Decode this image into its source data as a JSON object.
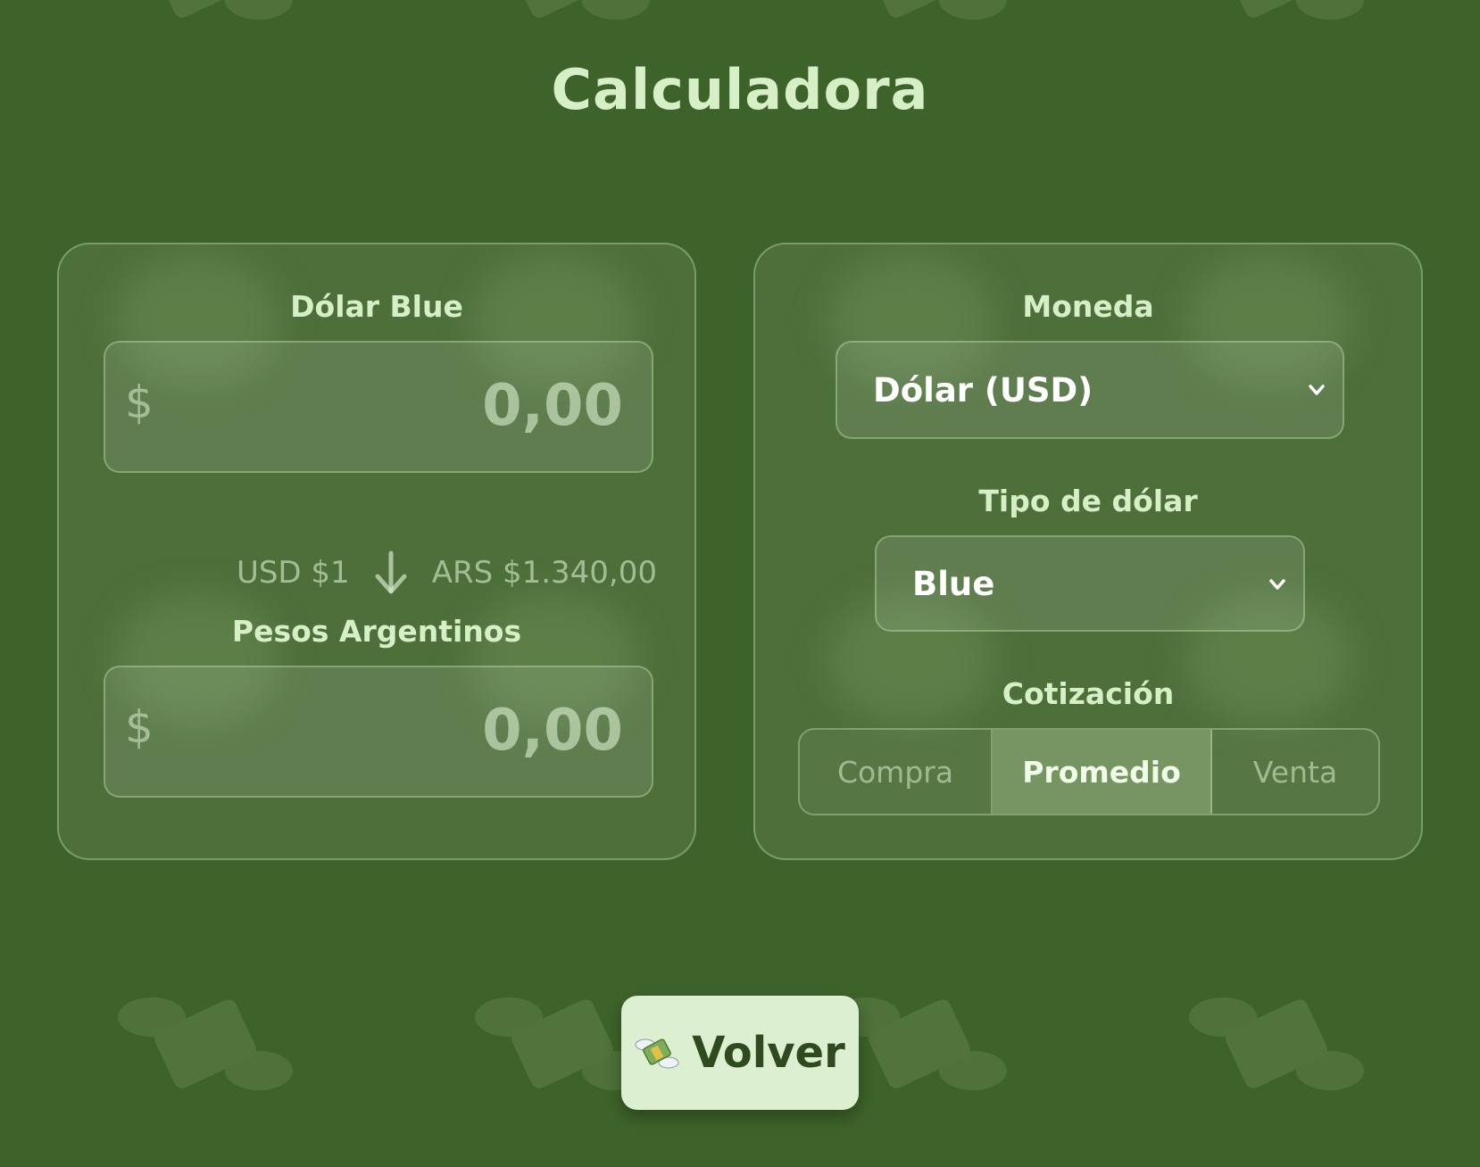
{
  "page": {
    "title": "Calculadora"
  },
  "converter": {
    "from_label": "Dólar Blue",
    "from_symbol": "$",
    "from_placeholder": "0,00",
    "rate_from": "USD $1",
    "rate_to": "ARS $1.340,00",
    "to_label": "Pesos Argentinos",
    "to_symbol": "$",
    "to_placeholder": "0,00"
  },
  "settings": {
    "currency_label": "Moneda",
    "currency_value": "Dólar (USD)",
    "type_label": "Tipo de dólar",
    "type_value": "Blue",
    "quote_label": "Cotización",
    "quote_options": [
      "Compra",
      "Promedio",
      "Venta"
    ],
    "quote_selected": "Promedio"
  },
  "footer": {
    "back_label": "Volver"
  },
  "colors": {
    "background": "#3e632a",
    "text_light": "#d6efc6",
    "button_bg": "#dcefd1",
    "button_text": "#2f4a1e"
  },
  "icons": {
    "background_pattern": "money-with-wings-icon",
    "rate_arrow": "arrow-down-icon",
    "select_chevron": "chevron-down-icon",
    "back_button": "money-with-wings-icon"
  }
}
